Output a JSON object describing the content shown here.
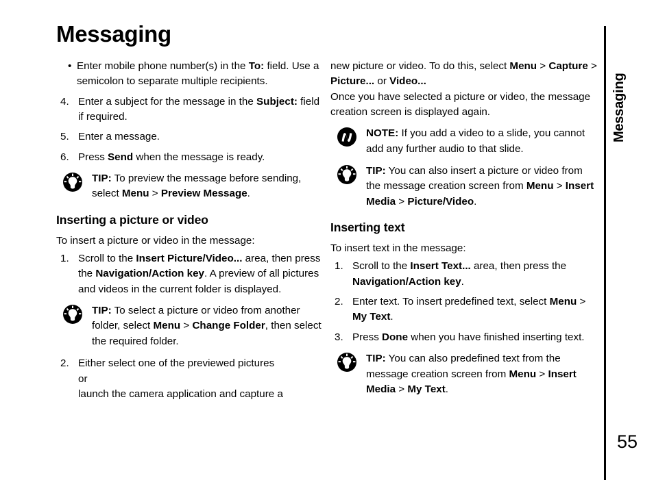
{
  "page": {
    "title": "Messaging",
    "number": "55",
    "side_tab": "Messaging"
  },
  "icons": {
    "tip": "lightbulb-icon",
    "note": "note-icon"
  },
  "left_column": {
    "bullet_1": {
      "mark": "•",
      "seg_1": "Enter mobile phone number(s) in the ",
      "bold_1": "To:",
      "seg_2": " field. Use a semicolon to separate multiple recipients."
    },
    "item_4": {
      "mark": "4.",
      "seg_1": "Enter a subject for the message in the ",
      "bold_1": "Subject:",
      "seg_2": " field if required."
    },
    "item_5": {
      "mark": "5.",
      "seg_1": "Enter a message."
    },
    "item_6": {
      "mark": "6.",
      "seg_1": "Press ",
      "bold_1": "Send",
      "seg_2": " when the message is ready."
    },
    "tip_1": {
      "label": "TIP:",
      "seg_1": " To preview the message before sending, select ",
      "bold_1": "Menu",
      "seg_2": " > ",
      "bold_2": "Preview Message",
      "seg_3": "."
    },
    "heading_1": "Inserting a picture or video",
    "intro_1": "To insert a picture or video in the message:",
    "item_1": {
      "mark": "1.",
      "seg_1": "Scroll to the ",
      "bold_1": "Insert Picture/Video...",
      "seg_2": " area, then press the ",
      "bold_2": "Navigation/Action key",
      "seg_3": ". A preview of all pictures and videos in the current folder is displayed."
    },
    "tip_2": {
      "label": "TIP:",
      "seg_1": " To select a picture or video from another folder, select ",
      "bold_1": "Menu",
      "seg_2": " > ",
      "bold_2": "Change Folder",
      "seg_3": ", then select the required folder."
    },
    "item_2": {
      "mark": "2.",
      "line_1": "Either select one of the previewed pictures",
      "line_2": "or",
      "line_3": "launch the camera application and capture a"
    }
  },
  "right_column": {
    "continuation": {
      "seg_1": "new picture or video. To do this, select ",
      "bold_1": "Menu",
      "seg_2": " > ",
      "bold_2": "Capture",
      "seg_3": " > ",
      "bold_3": "Picture...",
      "seg_4": " or ",
      "bold_4": "Video...",
      "seg_5": "Once you have selected a picture or video, the message creation screen is displayed again."
    },
    "note_1": {
      "label": "NOTE:",
      "seg_1": " If you add a video to a slide, you cannot add any further audio to that slide."
    },
    "tip_1": {
      "label": "TIP:",
      "seg_1": " You can also insert a picture or video from the message creation screen from ",
      "bold_1": "Menu",
      "seg_2": " > ",
      "bold_2": "Insert Media",
      "seg_3": " > ",
      "bold_3": "Picture/Video",
      "seg_4": "."
    },
    "heading_1": "Inserting text",
    "intro_1": "To insert text in the message:",
    "item_1": {
      "mark": "1.",
      "seg_1": "Scroll to the ",
      "bold_1": "Insert Text...",
      "seg_2": " area, then press the ",
      "bold_2": "Navigation/Action key",
      "seg_3": "."
    },
    "item_2": {
      "mark": "2.",
      "seg_1": "Enter text. To insert predefined text, select ",
      "bold_1": "Menu",
      "seg_2": " > ",
      "bold_2": "My Text",
      "seg_3": "."
    },
    "item_3": {
      "mark": "3.",
      "seg_1": "Press ",
      "bold_1": "Done",
      "seg_2": " when you have finished inserting text."
    },
    "tip_2": {
      "label": "TIP:",
      "seg_1": " You can also predefined text from the message creation screen from ",
      "bold_1": "Menu",
      "seg_2": " > ",
      "bold_2": "Insert Media",
      "seg_3": " > ",
      "bold_3": "My Text",
      "seg_4": "."
    }
  }
}
